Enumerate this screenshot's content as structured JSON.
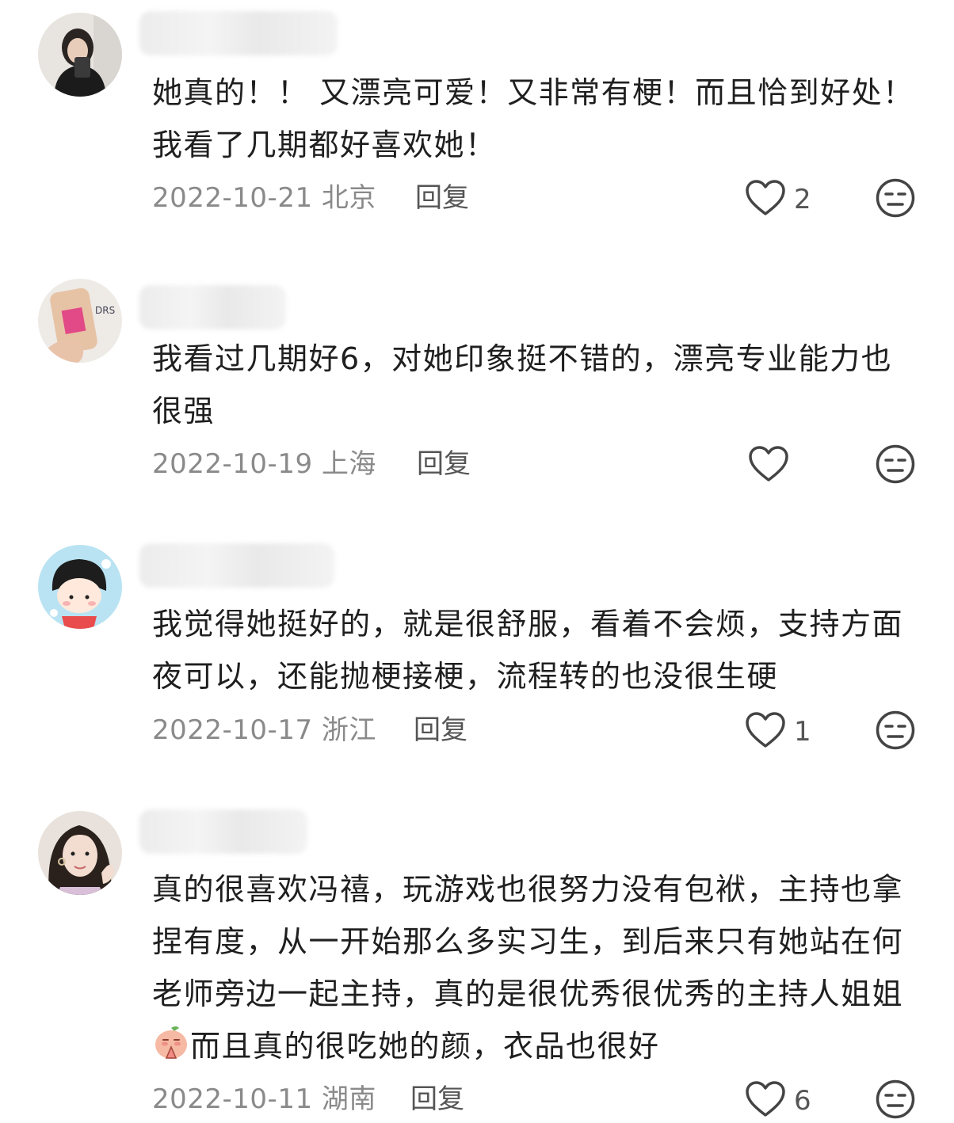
{
  "comments": [
    {
      "text": "她真的！！ 又漂亮可爱！又非常有梗！而且恰到好处！我看了几期都好喜欢她！",
      "date_location": "2022-10-21 北京",
      "reply_label": "回复",
      "like_count": "2"
    },
    {
      "text": "我看过几期好6，对她印象挺不错的，漂亮专业能力也很强",
      "date_location": "2022-10-19 上海",
      "reply_label": "回复",
      "like_count": ""
    },
    {
      "text": "我觉得她挺好的，就是很舒服，看着不会烦，支持方面夜可以，还能抛梗接梗，流程转的也没很生硬",
      "date_location": "2022-10-17 浙江",
      "reply_label": "回复",
      "like_count": "1"
    },
    {
      "text_before_emoji": "真的很喜欢冯禧，玩游戏也很努力没有包袱，主持也拿捏有度，从一开始那么多实习生，到后来只有她站在何老师旁边一起主持，真的是很优秀很优秀的主持人姐姐",
      "emoji": "peach-pray-emoji",
      "text_after_emoji": "而且真的很吃她的颜，衣品也很好",
      "date_location": "2022-10-11 湖南",
      "reply_label": "回复",
      "like_count": "6"
    }
  ],
  "colors": {
    "meta_text": "#8a8a8a",
    "icon_stroke": "#444444"
  }
}
